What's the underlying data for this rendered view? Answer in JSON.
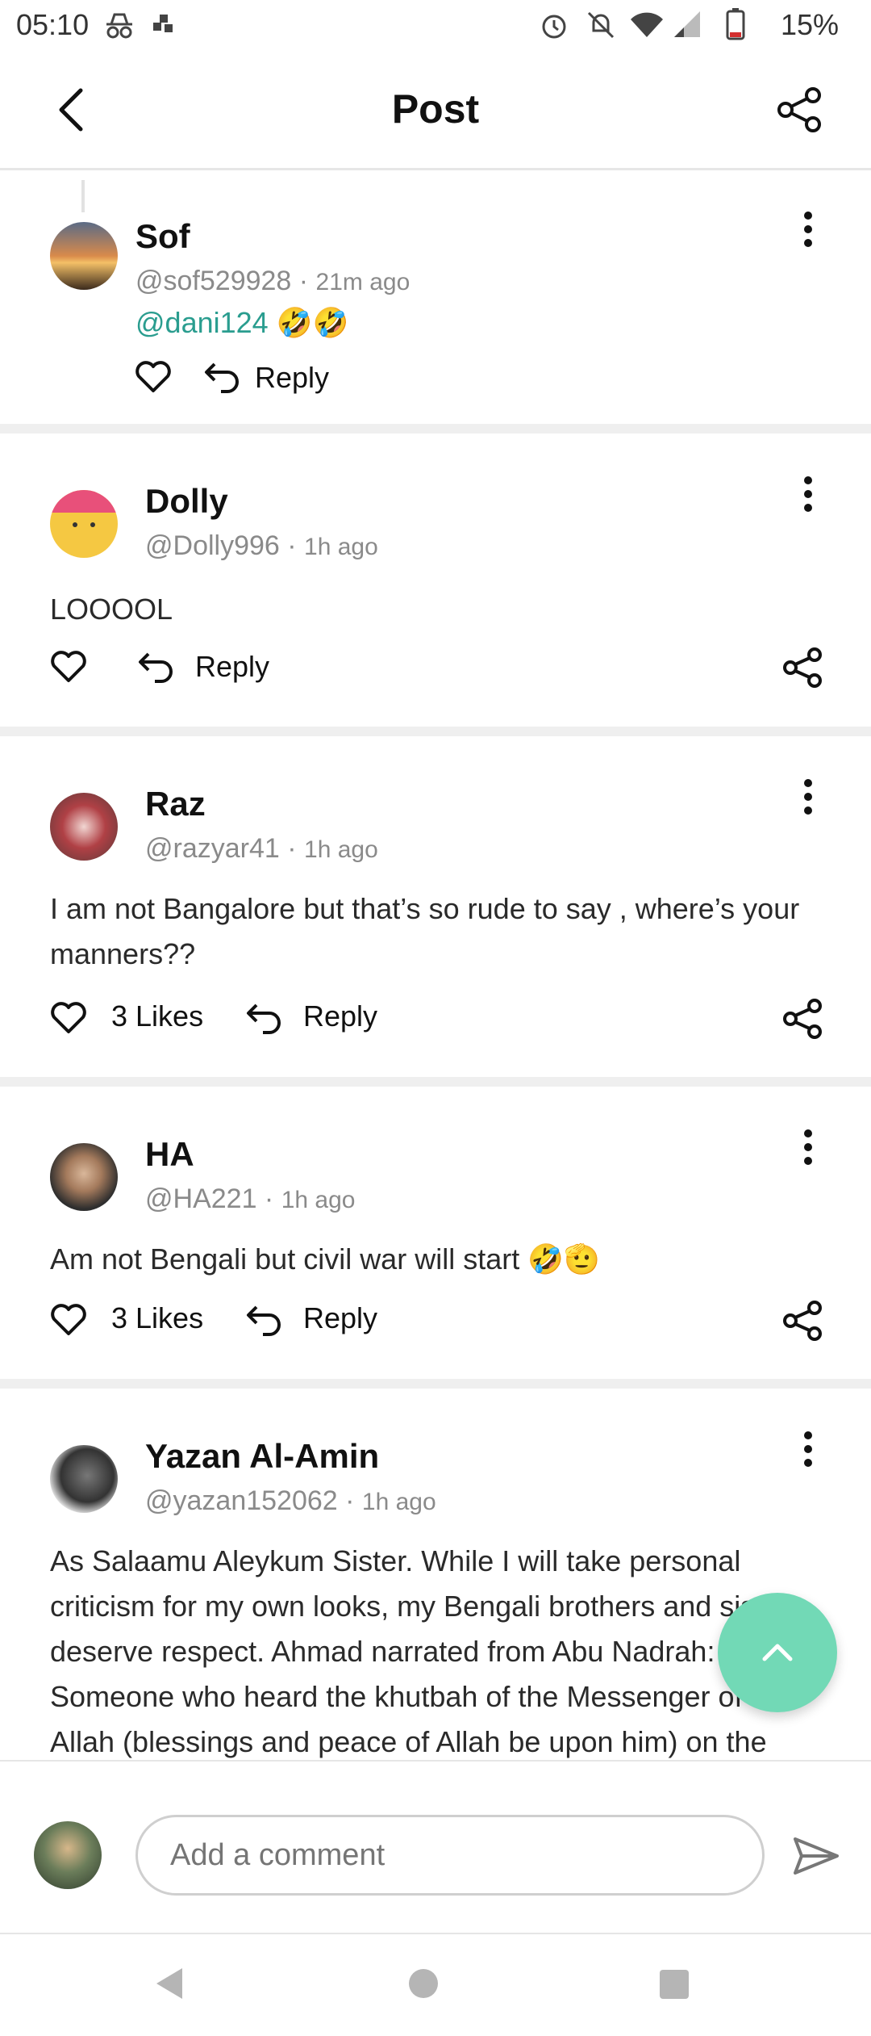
{
  "status_bar": {
    "time": "05:10",
    "battery": "15%"
  },
  "header": {
    "title": "Post"
  },
  "comments": [
    {
      "name": "Sof",
      "handle": "@sof529928",
      "time": "21m ago",
      "mention": "@dani124",
      "emoji": "🤣🤣",
      "likes": "",
      "reply": "Reply"
    },
    {
      "name": "Dolly",
      "handle": "@Dolly996",
      "time": "1h ago",
      "text": "LOOOOL",
      "likes": "",
      "reply": "Reply"
    },
    {
      "name": "Raz",
      "handle": "@razyar41",
      "time": "1h ago",
      "text_line1": "I am not Bangalore but that’s so rude to say , where’s your",
      "text_line2": "manners??",
      "likes": "3 Likes",
      "reply": "Reply"
    },
    {
      "name": "HA",
      "handle": "@HA221",
      "time": "1h ago",
      "text": "Am not Bengali but civil war will start 🤣🫡",
      "likes": "3 Likes",
      "reply": "Reply"
    },
    {
      "name": "Yazan Al-Amin",
      "handle": "@yazan152062",
      "time": "1h ago",
      "text_line1": "As Salaamu Aleykum Sister. While I will take personal",
      "text_line2": "criticism for my own looks, my Bengali brothers and sisters",
      "text_line3": "deserve respect. Ahmad narrated from Abu Nadrah:",
      "text_line4": "Someone who heard the khutbah of the Messenger of",
      "text_line5": "Allah (blessings and peace of Allah be upon him) on the"
    }
  ],
  "composer": {
    "placeholder": "Add a comment"
  },
  "colors": {
    "accent": "#72d9b6",
    "mention": "#2a9d8f"
  },
  "icons": [
    "back-icon",
    "share-icon",
    "more-icon",
    "heart-icon",
    "reply-icon",
    "send-icon",
    "scroll-up-icon"
  ]
}
